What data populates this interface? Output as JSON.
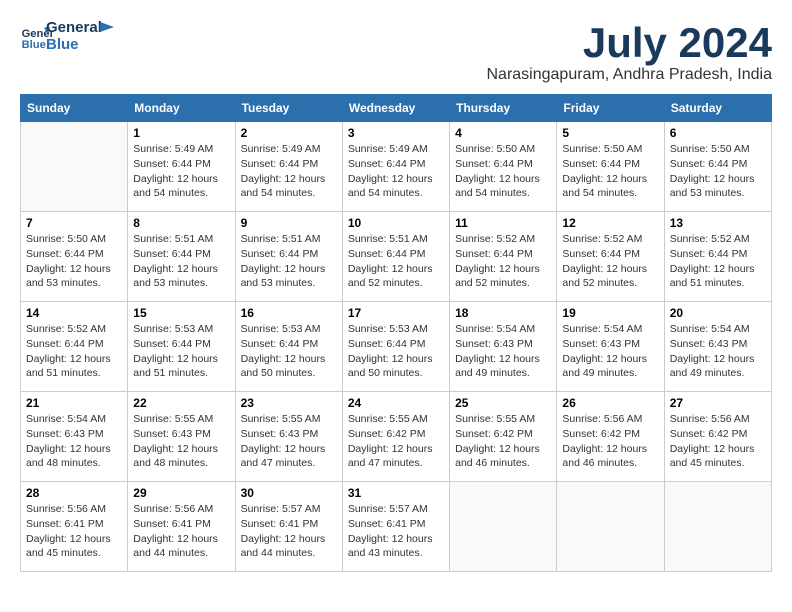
{
  "logo": {
    "name": "General",
    "name2": "Blue"
  },
  "title": "July 2024",
  "location": "Narasingapuram, Andhra Pradesh, India",
  "days_of_week": [
    "Sunday",
    "Monday",
    "Tuesday",
    "Wednesday",
    "Thursday",
    "Friday",
    "Saturday"
  ],
  "weeks": [
    [
      {
        "day": "",
        "info": ""
      },
      {
        "day": "1",
        "info": "Sunrise: 5:49 AM\nSunset: 6:44 PM\nDaylight: 12 hours\nand 54 minutes."
      },
      {
        "day": "2",
        "info": "Sunrise: 5:49 AM\nSunset: 6:44 PM\nDaylight: 12 hours\nand 54 minutes."
      },
      {
        "day": "3",
        "info": "Sunrise: 5:49 AM\nSunset: 6:44 PM\nDaylight: 12 hours\nand 54 minutes."
      },
      {
        "day": "4",
        "info": "Sunrise: 5:50 AM\nSunset: 6:44 PM\nDaylight: 12 hours\nand 54 minutes."
      },
      {
        "day": "5",
        "info": "Sunrise: 5:50 AM\nSunset: 6:44 PM\nDaylight: 12 hours\nand 54 minutes."
      },
      {
        "day": "6",
        "info": "Sunrise: 5:50 AM\nSunset: 6:44 PM\nDaylight: 12 hours\nand 53 minutes."
      }
    ],
    [
      {
        "day": "7",
        "info": "Sunrise: 5:50 AM\nSunset: 6:44 PM\nDaylight: 12 hours\nand 53 minutes."
      },
      {
        "day": "8",
        "info": "Sunrise: 5:51 AM\nSunset: 6:44 PM\nDaylight: 12 hours\nand 53 minutes."
      },
      {
        "day": "9",
        "info": "Sunrise: 5:51 AM\nSunset: 6:44 PM\nDaylight: 12 hours\nand 53 minutes."
      },
      {
        "day": "10",
        "info": "Sunrise: 5:51 AM\nSunset: 6:44 PM\nDaylight: 12 hours\nand 52 minutes."
      },
      {
        "day": "11",
        "info": "Sunrise: 5:52 AM\nSunset: 6:44 PM\nDaylight: 12 hours\nand 52 minutes."
      },
      {
        "day": "12",
        "info": "Sunrise: 5:52 AM\nSunset: 6:44 PM\nDaylight: 12 hours\nand 52 minutes."
      },
      {
        "day": "13",
        "info": "Sunrise: 5:52 AM\nSunset: 6:44 PM\nDaylight: 12 hours\nand 51 minutes."
      }
    ],
    [
      {
        "day": "14",
        "info": "Sunrise: 5:52 AM\nSunset: 6:44 PM\nDaylight: 12 hours\nand 51 minutes."
      },
      {
        "day": "15",
        "info": "Sunrise: 5:53 AM\nSunset: 6:44 PM\nDaylight: 12 hours\nand 51 minutes."
      },
      {
        "day": "16",
        "info": "Sunrise: 5:53 AM\nSunset: 6:44 PM\nDaylight: 12 hours\nand 50 minutes."
      },
      {
        "day": "17",
        "info": "Sunrise: 5:53 AM\nSunset: 6:44 PM\nDaylight: 12 hours\nand 50 minutes."
      },
      {
        "day": "18",
        "info": "Sunrise: 5:54 AM\nSunset: 6:43 PM\nDaylight: 12 hours\nand 49 minutes."
      },
      {
        "day": "19",
        "info": "Sunrise: 5:54 AM\nSunset: 6:43 PM\nDaylight: 12 hours\nand 49 minutes."
      },
      {
        "day": "20",
        "info": "Sunrise: 5:54 AM\nSunset: 6:43 PM\nDaylight: 12 hours\nand 49 minutes."
      }
    ],
    [
      {
        "day": "21",
        "info": "Sunrise: 5:54 AM\nSunset: 6:43 PM\nDaylight: 12 hours\nand 48 minutes."
      },
      {
        "day": "22",
        "info": "Sunrise: 5:55 AM\nSunset: 6:43 PM\nDaylight: 12 hours\nand 48 minutes."
      },
      {
        "day": "23",
        "info": "Sunrise: 5:55 AM\nSunset: 6:43 PM\nDaylight: 12 hours\nand 47 minutes."
      },
      {
        "day": "24",
        "info": "Sunrise: 5:55 AM\nSunset: 6:42 PM\nDaylight: 12 hours\nand 47 minutes."
      },
      {
        "day": "25",
        "info": "Sunrise: 5:55 AM\nSunset: 6:42 PM\nDaylight: 12 hours\nand 46 minutes."
      },
      {
        "day": "26",
        "info": "Sunrise: 5:56 AM\nSunset: 6:42 PM\nDaylight: 12 hours\nand 46 minutes."
      },
      {
        "day": "27",
        "info": "Sunrise: 5:56 AM\nSunset: 6:42 PM\nDaylight: 12 hours\nand 45 minutes."
      }
    ],
    [
      {
        "day": "28",
        "info": "Sunrise: 5:56 AM\nSunset: 6:41 PM\nDaylight: 12 hours\nand 45 minutes."
      },
      {
        "day": "29",
        "info": "Sunrise: 5:56 AM\nSunset: 6:41 PM\nDaylight: 12 hours\nand 44 minutes."
      },
      {
        "day": "30",
        "info": "Sunrise: 5:57 AM\nSunset: 6:41 PM\nDaylight: 12 hours\nand 44 minutes."
      },
      {
        "day": "31",
        "info": "Sunrise: 5:57 AM\nSunset: 6:41 PM\nDaylight: 12 hours\nand 43 minutes."
      },
      {
        "day": "",
        "info": ""
      },
      {
        "day": "",
        "info": ""
      },
      {
        "day": "",
        "info": ""
      }
    ]
  ]
}
